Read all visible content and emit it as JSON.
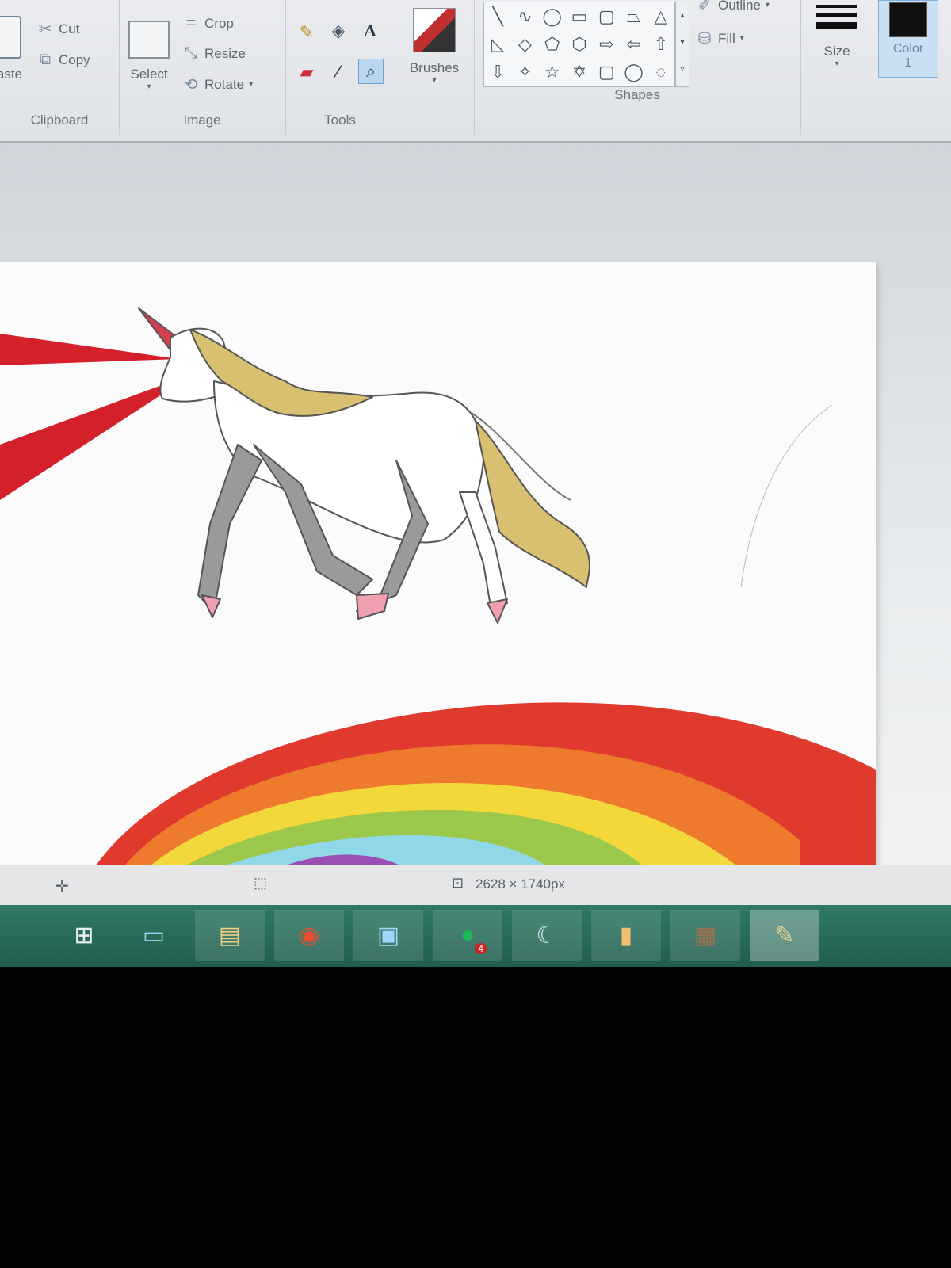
{
  "ribbon": {
    "clipboard": {
      "paste_label": "aste",
      "cut_label": "Cut",
      "copy_label": "Copy",
      "group_label": "Clipboard"
    },
    "image": {
      "select_label": "Select",
      "crop_label": "Crop",
      "resize_label": "Resize",
      "rotate_label": "Rotate",
      "group_label": "Image"
    },
    "tools": {
      "group_label": "Tools",
      "items": [
        "pencil-icon",
        "fill-bucket-icon",
        "text-icon",
        "eraser-icon",
        "color-picker-icon",
        "magnifier-icon"
      ],
      "active": "magnifier-icon"
    },
    "brushes": {
      "label": "Brushes"
    },
    "shapes": {
      "group_label": "Shapes",
      "outline_label": "Outline",
      "fill_label": "Fill",
      "gallery": [
        "line",
        "curve",
        "oval",
        "rectangle",
        "rounded-rectangle",
        "polygon",
        "triangle",
        "right-triangle",
        "diamond",
        "pentagon",
        "hexagon",
        "right-arrow",
        "left-arrow",
        "up-arrow",
        "down-arrow",
        "four-point-star",
        "five-point-star",
        "six-point-star",
        "rounded-callout",
        "oval-callout",
        "cloud-callout"
      ]
    },
    "size": {
      "label": "Size"
    },
    "color1": {
      "label": "Color",
      "number": "1",
      "value": "#101010"
    }
  },
  "canvas": {
    "rainbow_colors": [
      "#e03a2e",
      "#ee7a2e",
      "#f2d83a",
      "#9bc84a",
      "#8fd8e8",
      "#9a4fb4"
    ],
    "laser_color": "#d4202a",
    "mane_color": "#d8c070",
    "shadow_color": "#9a9a9a",
    "hoof_color": "#f2a0b0"
  },
  "status": {
    "dimensions": "2628 × 1740px"
  },
  "taskbar": {
    "items": [
      "start-icon",
      "desktop-icon",
      "file-explorer-icon",
      "chrome-icon",
      "remote-desktop-icon",
      "spotify-icon",
      "moon-app-icon",
      "folder-icon",
      "minecraft-icon",
      "paint-icon"
    ],
    "spotify_badge": "4"
  }
}
